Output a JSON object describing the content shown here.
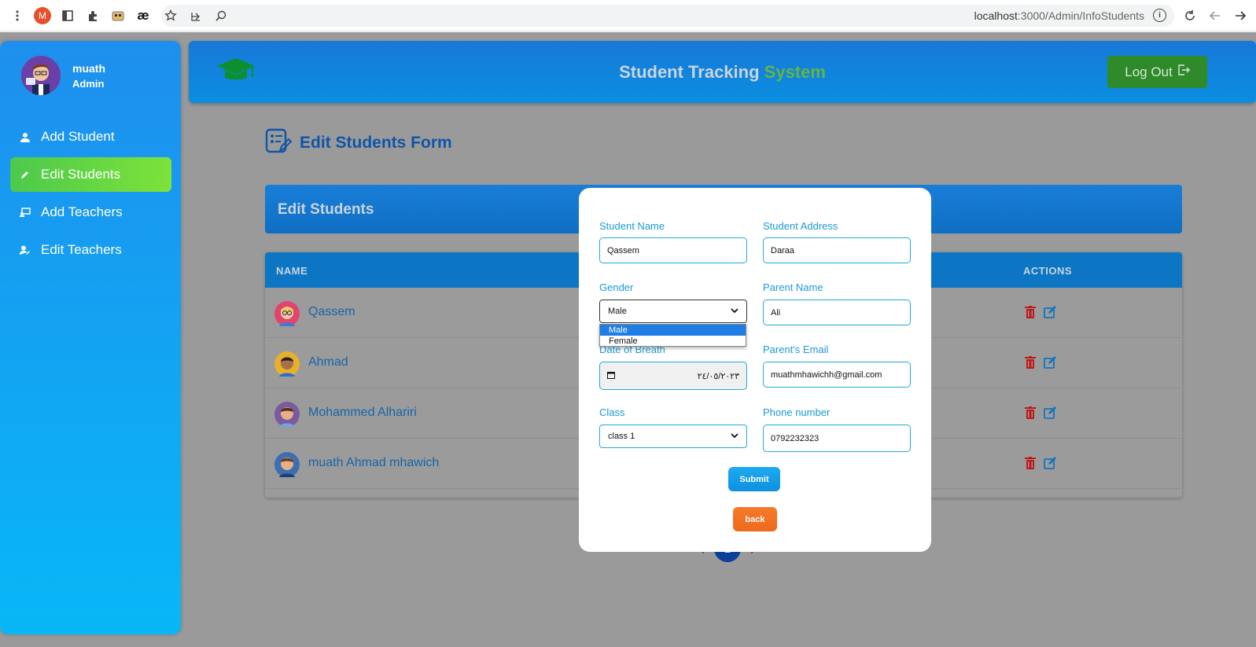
{
  "browser": {
    "profile_initial": "M",
    "ae_label": "æ",
    "url_host": "localhost",
    "url_path": ":3000/Admin/InfoStudents"
  },
  "sidebar": {
    "user_name": "muath",
    "user_role": "Admin",
    "items": [
      {
        "label": "Add Student",
        "icon": "student-icon",
        "active": false
      },
      {
        "label": "Edit Students",
        "icon": "pencil-icon",
        "active": true
      },
      {
        "label": "Add Teachers",
        "icon": "teacher-board-icon",
        "active": false
      },
      {
        "label": "Edit Teachers",
        "icon": "user-edit-icon",
        "active": false
      }
    ]
  },
  "header": {
    "title_main": "Student Tracking ",
    "title_accent": "System",
    "logout_label": "Log Out"
  },
  "page": {
    "heading": "Edit Students Form",
    "card_title": "Edit Students"
  },
  "table": {
    "columns": [
      "NAME",
      "ACTIONS"
    ],
    "rows": [
      {
        "name": "Qassem"
      },
      {
        "name": "Ahmad"
      },
      {
        "name": "Mohammed Alhariri"
      },
      {
        "name": "muath Ahmad mhawich"
      }
    ]
  },
  "pagination": {
    "current": "1"
  },
  "modal": {
    "student_name_label": "Student Name",
    "student_name_value": "Qassem",
    "student_address_label": "Student Address",
    "student_address_value": "Daraa",
    "gender_label": "Gender",
    "gender_value": "Male",
    "gender_options": [
      "Male",
      "Female"
    ],
    "parent_name_label": "Parent Name",
    "parent_name_value": "Ali",
    "dob_label": "Date of Breath",
    "dob_value": "٢٤/٠٥/٢٠٢٣",
    "parent_email_label": "Parent's Email",
    "parent_email_value": "muathmhawichh@gmail.com",
    "class_label": "Class",
    "class_value": "class 1",
    "phone_label": "Phone number",
    "phone_value": "0792232323",
    "submit_label": "Submit",
    "back_label": "back"
  },
  "colors": {
    "sidebar_top": "#1e8fee",
    "sidebar_bottom": "#08b7f6",
    "active_nav": "#5fd43f",
    "header_blue": "#1878d8",
    "accent_green": "#64b545",
    "submit_blue": "#0e90e0",
    "back_orange": "#f47a2a",
    "overlay_gray": "#9a9a9a"
  }
}
